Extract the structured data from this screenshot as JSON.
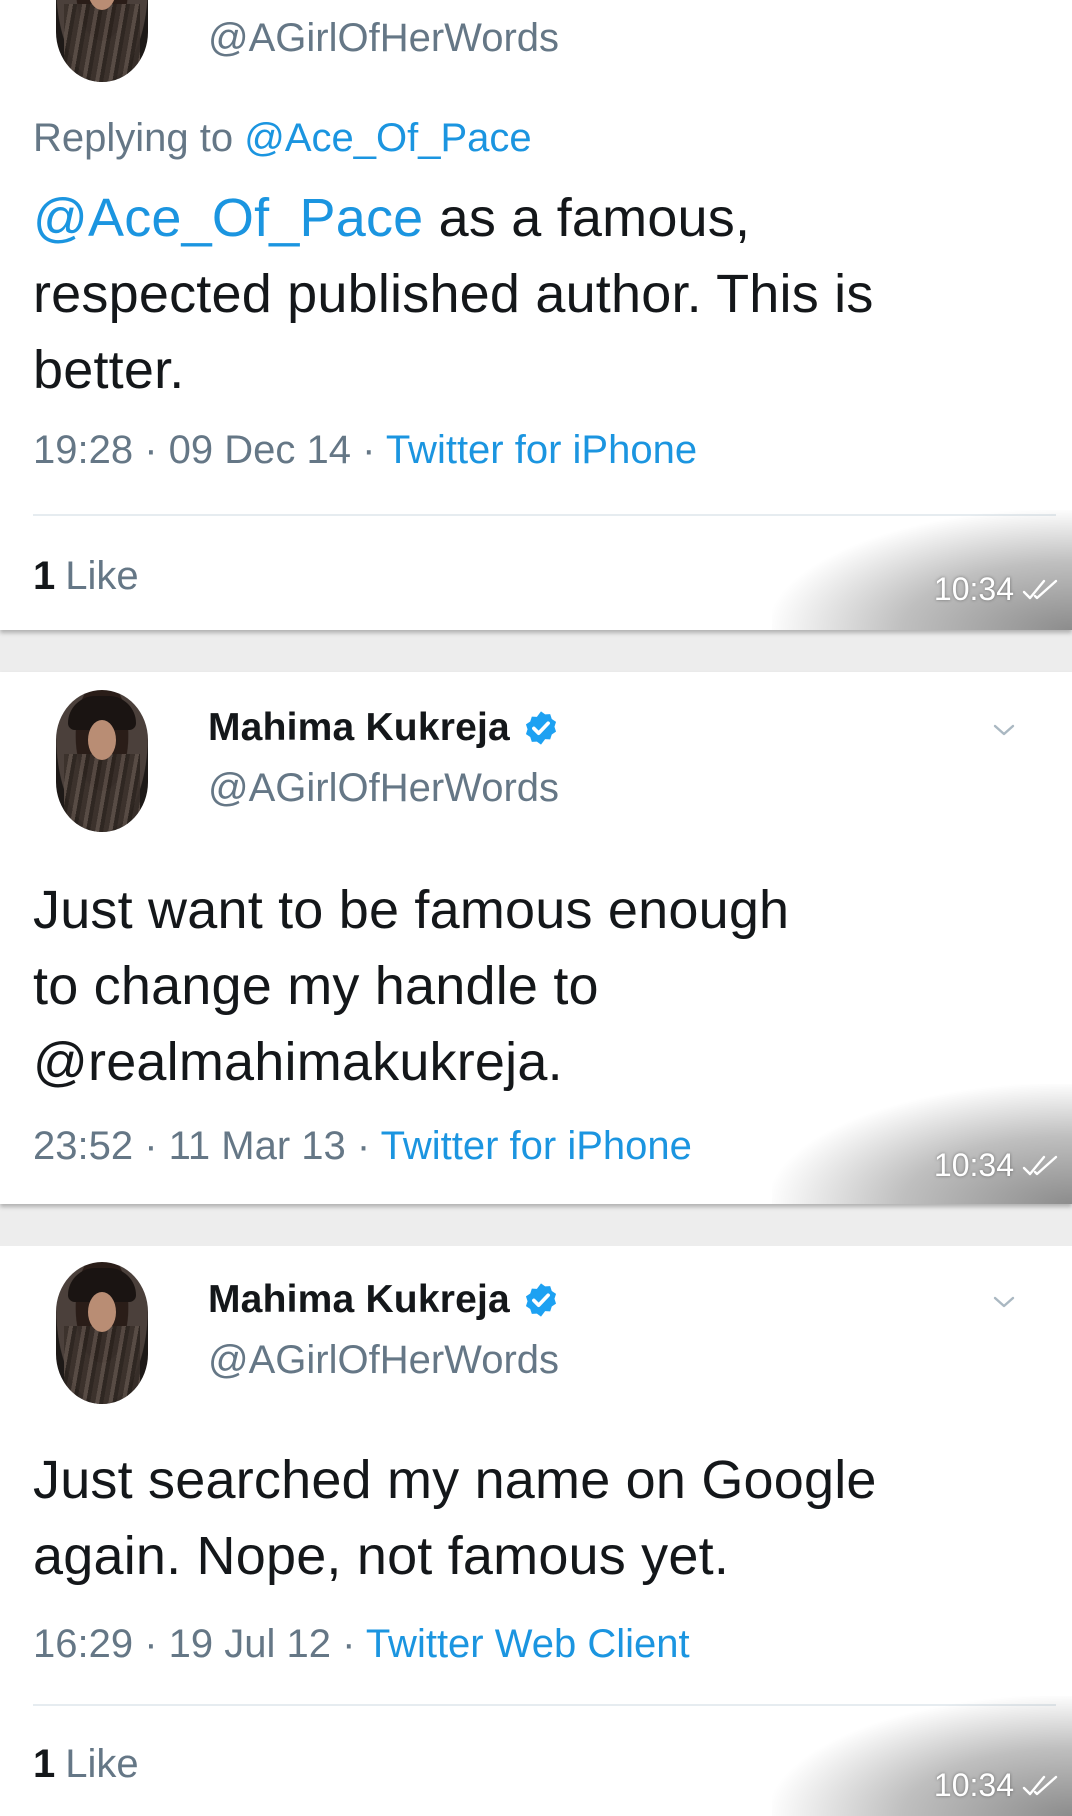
{
  "colors": {
    "link_blue": "#1b95e0",
    "secondary_gray": "#657786",
    "text_dark": "#14171a",
    "background": "#ededed",
    "verified_blue": "#1da1f2"
  },
  "icons": {
    "verified": "verified-badge-icon",
    "caret": "chevron-down-icon",
    "read_receipt": "double-check-icon"
  },
  "tweets": [
    {
      "handle": "@AGirlOfHerWords",
      "replying_label": "Replying to",
      "replying_to": "@Ace_Of_Pace",
      "mention": "@Ace_Of_Pace",
      "text_line1_rest": " as a famous,",
      "text_line2": "respected published author. This is",
      "text_line3": "better.",
      "time": "19:28",
      "date": "09 Dec 14",
      "source": "Twitter for iPhone",
      "like_count": "1",
      "like_label": "Like",
      "message_time": "10:34"
    },
    {
      "name": "Mahima Kukreja",
      "handle": "@AGirlOfHerWords",
      "text_line1": "Just want to be famous enough",
      "text_line2": "to change my handle to",
      "text_line3": "@realmahimakukreja.",
      "time": "23:52",
      "date": "11 Mar 13",
      "source": "Twitter for iPhone",
      "message_time": "10:34"
    },
    {
      "name": "Mahima Kukreja",
      "handle": "@AGirlOfHerWords",
      "text_line1": "Just searched my name on Google",
      "text_line2": "again. Nope, not famous yet.",
      "time": "16:29",
      "date": "19 Jul 12",
      "source": "Twitter Web Client",
      "like_count": "1",
      "like_label": "Like",
      "message_time": "10:34"
    }
  ],
  "separator": " · "
}
